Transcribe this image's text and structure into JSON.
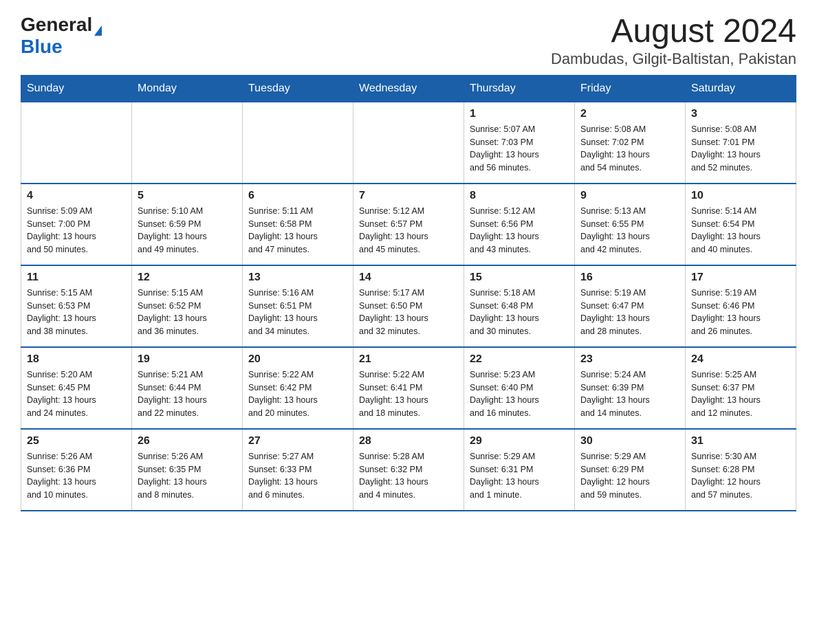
{
  "header": {
    "logo_general": "General",
    "logo_blue": "Blue",
    "month": "August 2024",
    "location": "Dambudas, Gilgit-Baltistan, Pakistan"
  },
  "weekdays": [
    "Sunday",
    "Monday",
    "Tuesday",
    "Wednesday",
    "Thursday",
    "Friday",
    "Saturday"
  ],
  "weeks": [
    [
      {
        "day": "",
        "info": ""
      },
      {
        "day": "",
        "info": ""
      },
      {
        "day": "",
        "info": ""
      },
      {
        "day": "",
        "info": ""
      },
      {
        "day": "1",
        "info": "Sunrise: 5:07 AM\nSunset: 7:03 PM\nDaylight: 13 hours\nand 56 minutes."
      },
      {
        "day": "2",
        "info": "Sunrise: 5:08 AM\nSunset: 7:02 PM\nDaylight: 13 hours\nand 54 minutes."
      },
      {
        "day": "3",
        "info": "Sunrise: 5:08 AM\nSunset: 7:01 PM\nDaylight: 13 hours\nand 52 minutes."
      }
    ],
    [
      {
        "day": "4",
        "info": "Sunrise: 5:09 AM\nSunset: 7:00 PM\nDaylight: 13 hours\nand 50 minutes."
      },
      {
        "day": "5",
        "info": "Sunrise: 5:10 AM\nSunset: 6:59 PM\nDaylight: 13 hours\nand 49 minutes."
      },
      {
        "day": "6",
        "info": "Sunrise: 5:11 AM\nSunset: 6:58 PM\nDaylight: 13 hours\nand 47 minutes."
      },
      {
        "day": "7",
        "info": "Sunrise: 5:12 AM\nSunset: 6:57 PM\nDaylight: 13 hours\nand 45 minutes."
      },
      {
        "day": "8",
        "info": "Sunrise: 5:12 AM\nSunset: 6:56 PM\nDaylight: 13 hours\nand 43 minutes."
      },
      {
        "day": "9",
        "info": "Sunrise: 5:13 AM\nSunset: 6:55 PM\nDaylight: 13 hours\nand 42 minutes."
      },
      {
        "day": "10",
        "info": "Sunrise: 5:14 AM\nSunset: 6:54 PM\nDaylight: 13 hours\nand 40 minutes."
      }
    ],
    [
      {
        "day": "11",
        "info": "Sunrise: 5:15 AM\nSunset: 6:53 PM\nDaylight: 13 hours\nand 38 minutes."
      },
      {
        "day": "12",
        "info": "Sunrise: 5:15 AM\nSunset: 6:52 PM\nDaylight: 13 hours\nand 36 minutes."
      },
      {
        "day": "13",
        "info": "Sunrise: 5:16 AM\nSunset: 6:51 PM\nDaylight: 13 hours\nand 34 minutes."
      },
      {
        "day": "14",
        "info": "Sunrise: 5:17 AM\nSunset: 6:50 PM\nDaylight: 13 hours\nand 32 minutes."
      },
      {
        "day": "15",
        "info": "Sunrise: 5:18 AM\nSunset: 6:48 PM\nDaylight: 13 hours\nand 30 minutes."
      },
      {
        "day": "16",
        "info": "Sunrise: 5:19 AM\nSunset: 6:47 PM\nDaylight: 13 hours\nand 28 minutes."
      },
      {
        "day": "17",
        "info": "Sunrise: 5:19 AM\nSunset: 6:46 PM\nDaylight: 13 hours\nand 26 minutes."
      }
    ],
    [
      {
        "day": "18",
        "info": "Sunrise: 5:20 AM\nSunset: 6:45 PM\nDaylight: 13 hours\nand 24 minutes."
      },
      {
        "day": "19",
        "info": "Sunrise: 5:21 AM\nSunset: 6:44 PM\nDaylight: 13 hours\nand 22 minutes."
      },
      {
        "day": "20",
        "info": "Sunrise: 5:22 AM\nSunset: 6:42 PM\nDaylight: 13 hours\nand 20 minutes."
      },
      {
        "day": "21",
        "info": "Sunrise: 5:22 AM\nSunset: 6:41 PM\nDaylight: 13 hours\nand 18 minutes."
      },
      {
        "day": "22",
        "info": "Sunrise: 5:23 AM\nSunset: 6:40 PM\nDaylight: 13 hours\nand 16 minutes."
      },
      {
        "day": "23",
        "info": "Sunrise: 5:24 AM\nSunset: 6:39 PM\nDaylight: 13 hours\nand 14 minutes."
      },
      {
        "day": "24",
        "info": "Sunrise: 5:25 AM\nSunset: 6:37 PM\nDaylight: 13 hours\nand 12 minutes."
      }
    ],
    [
      {
        "day": "25",
        "info": "Sunrise: 5:26 AM\nSunset: 6:36 PM\nDaylight: 13 hours\nand 10 minutes."
      },
      {
        "day": "26",
        "info": "Sunrise: 5:26 AM\nSunset: 6:35 PM\nDaylight: 13 hours\nand 8 minutes."
      },
      {
        "day": "27",
        "info": "Sunrise: 5:27 AM\nSunset: 6:33 PM\nDaylight: 13 hours\nand 6 minutes."
      },
      {
        "day": "28",
        "info": "Sunrise: 5:28 AM\nSunset: 6:32 PM\nDaylight: 13 hours\nand 4 minutes."
      },
      {
        "day": "29",
        "info": "Sunrise: 5:29 AM\nSunset: 6:31 PM\nDaylight: 13 hours\nand 1 minute."
      },
      {
        "day": "30",
        "info": "Sunrise: 5:29 AM\nSunset: 6:29 PM\nDaylight: 12 hours\nand 59 minutes."
      },
      {
        "day": "31",
        "info": "Sunrise: 5:30 AM\nSunset: 6:28 PM\nDaylight: 12 hours\nand 57 minutes."
      }
    ]
  ]
}
